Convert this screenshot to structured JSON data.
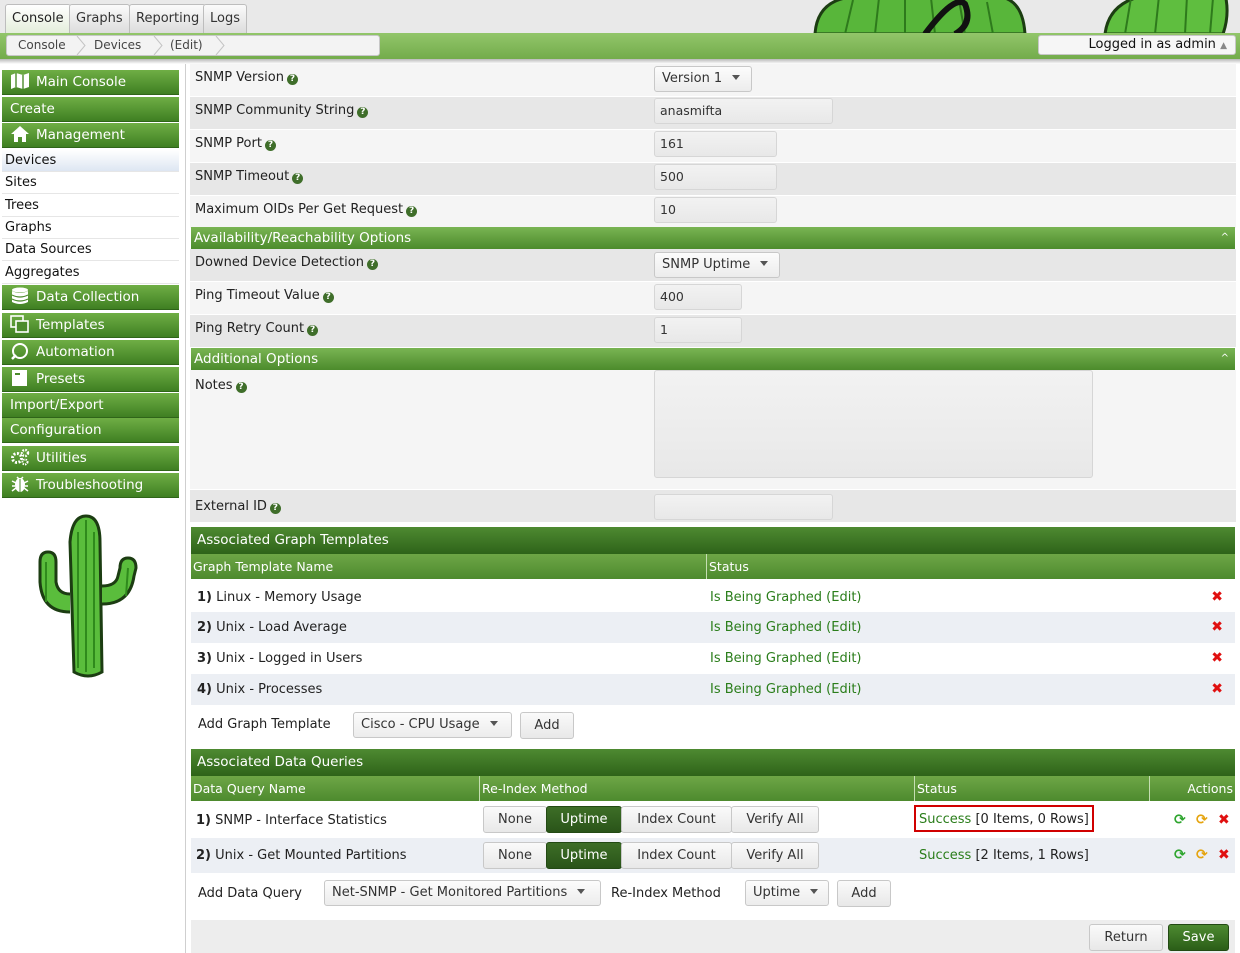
{
  "tabs": [
    "Console",
    "Graphs",
    "Reporting",
    "Logs"
  ],
  "breadcrumb": [
    "Console",
    "Devices",
    "(Edit)"
  ],
  "user": {
    "logged_in": "Logged in as admin"
  },
  "sidebar": {
    "main_console": "Main Console",
    "create": "Create",
    "management": "Management",
    "management_items": [
      "Devices",
      "Sites",
      "Trees",
      "Graphs",
      "Data Sources",
      "Aggregates"
    ],
    "data_collection": "Data Collection",
    "templates": "Templates",
    "automation": "Automation",
    "presets": "Presets",
    "import_export": "Import/Export",
    "configuration": "Configuration",
    "utilities": "Utilities",
    "troubleshooting": "Troubleshooting"
  },
  "form": {
    "snmp_version_label": "SNMP Version",
    "snmp_version_value": "Version 1",
    "snmp_community_label": "SNMP Community String",
    "snmp_community_value": "anasmifta",
    "snmp_port_label": "SNMP Port",
    "snmp_port_value": "161",
    "snmp_timeout_label": "SNMP Timeout",
    "snmp_timeout_value": "500",
    "max_oids_label": "Maximum OIDs Per Get Request",
    "max_oids_value": "10",
    "availability_section": "Availability/Reachability Options",
    "downed_label": "Downed Device Detection",
    "downed_value": "SNMP Uptime",
    "ping_timeout_label": "Ping Timeout Value",
    "ping_timeout_value": "400",
    "ping_retry_label": "Ping Retry Count",
    "ping_retry_value": "1",
    "additional_section": "Additional Options",
    "notes_label": "Notes",
    "external_id_label": "External ID"
  },
  "graph_templates": {
    "title": "Associated Graph Templates",
    "col_name": "Graph Template Name",
    "col_status": "Status",
    "rows": [
      {
        "num": "1)",
        "name": "Linux - Memory Usage",
        "status": "Is Being Graphed",
        "edit": "(Edit)"
      },
      {
        "num": "2)",
        "name": "Unix - Load Average",
        "status": "Is Being Graphed",
        "edit": "(Edit)"
      },
      {
        "num": "3)",
        "name": "Unix - Logged in Users",
        "status": "Is Being Graphed",
        "edit": "(Edit)"
      },
      {
        "num": "4)",
        "name": "Unix - Processes",
        "status": "Is Being Graphed",
        "edit": "(Edit)"
      }
    ],
    "add_label": "Add Graph Template",
    "add_select": "Cisco - CPU Usage",
    "add_button": "Add"
  },
  "data_queries": {
    "title": "Associated Data Queries",
    "col_name": "Data Query Name",
    "col_reindex": "Re-Index Method",
    "col_status": "Status",
    "col_actions": "Actions",
    "reindex_buttons": [
      "None",
      "Uptime",
      "Index Count",
      "Verify All"
    ],
    "rows": [
      {
        "num": "1)",
        "name": "SNMP - Interface Statistics",
        "status": "Success",
        "detail": "[0 Items, 0 Rows]"
      },
      {
        "num": "2)",
        "name": "Unix - Get Mounted Partitions",
        "status": "Success",
        "detail": "[2 Items, 1 Rows]"
      }
    ],
    "add_label": "Add Data Query",
    "add_select": "Net-SNMP - Get Monitored Partitions",
    "reindex_label": "Re-Index Method",
    "reindex_select": "Uptime",
    "add_button": "Add"
  },
  "footer": {
    "return": "Return",
    "save": "Save"
  }
}
